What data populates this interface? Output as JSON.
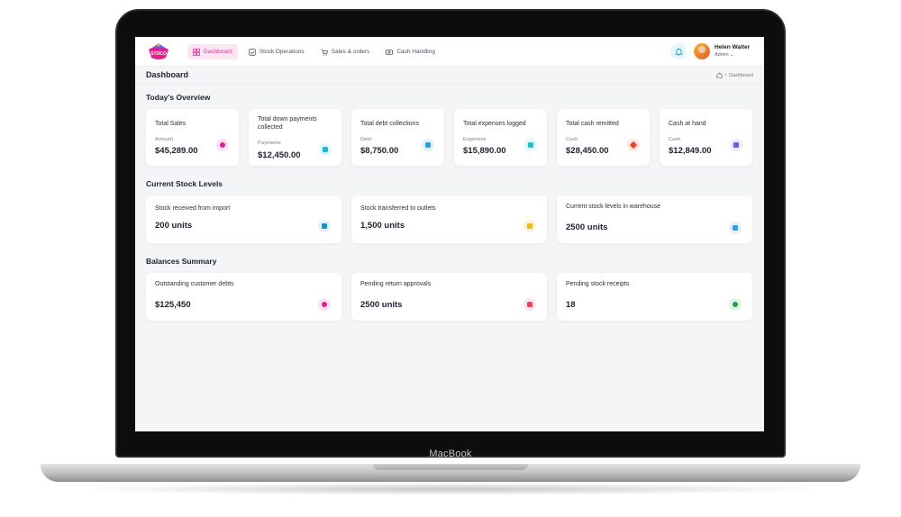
{
  "laptop": {
    "brand": "MacBook"
  },
  "app": {
    "logo_text": "STOCO"
  },
  "nav": [
    {
      "label": "Dashboard",
      "icon": "grid-icon",
      "active": true
    },
    {
      "label": "Stock Operations",
      "icon": "box-icon",
      "active": false
    },
    {
      "label": "Sales & orders",
      "icon": "cart-icon",
      "active": false
    },
    {
      "label": "Cash Handling",
      "icon": "cash-icon",
      "active": false
    }
  ],
  "user": {
    "name": "Helen Walter",
    "role": "Admin"
  },
  "page": {
    "title": "Dashboard",
    "breadcrumb": "Dashboard",
    "breadcrumb_sep": "/"
  },
  "overview": {
    "title": "Today's Overview",
    "cards": [
      {
        "title": "Total Sales",
        "label": "Amount",
        "value": "$45,289.00",
        "icon": "dollar-icon",
        "color": "#e3208f"
      },
      {
        "title": "Total down payments collected",
        "label": "Payments",
        "value": "$12,450.00",
        "icon": "wallet-icon",
        "color": "#1fb7d6"
      },
      {
        "title": "Total debt collections",
        "label": "Debt",
        "value": "$8,750.00",
        "icon": "document-icon",
        "color": "#2d9ee0"
      },
      {
        "title": "Total expenses logged",
        "label": "Expenses",
        "value": "$15,890.00",
        "icon": "receipt-icon",
        "color": "#1fc1d6"
      },
      {
        "title": "Total cash remitted",
        "label": "Cash",
        "value": "$28,450.00",
        "icon": "tag-icon",
        "color": "#e8452c"
      },
      {
        "title": "Cash at hand",
        "label": "Cash",
        "value": "$12,849.00",
        "icon": "wallet-icon",
        "color": "#6b5be6"
      }
    ]
  },
  "stock": {
    "title": "Current Stock Levels",
    "cards": [
      {
        "title": "Stock received from import",
        "value": "200 units",
        "icon": "inbox-icon",
        "color": "#1a8fd0"
      },
      {
        "title": "Stock transferred to outlets",
        "value": "1,500 units",
        "icon": "transfer-icon",
        "color": "#f4b71d"
      },
      {
        "title": "Current stock levels in warehouse",
        "value": "2500 units",
        "icon": "warehouse-icon",
        "color": "#2d9ee0"
      }
    ]
  },
  "balances": {
    "title": "Balances Summary",
    "cards": [
      {
        "title": "Outstanding customer debts",
        "value": "$125,450",
        "icon": "dollar-icon",
        "color": "#e3208f"
      },
      {
        "title": "Pending return approvals",
        "value": "2500 units",
        "icon": "return-icon",
        "color": "#e8455c"
      },
      {
        "title": "Pending stock receipts",
        "value": "18",
        "icon": "dollar-icon",
        "color": "#1fa34a"
      }
    ]
  }
}
